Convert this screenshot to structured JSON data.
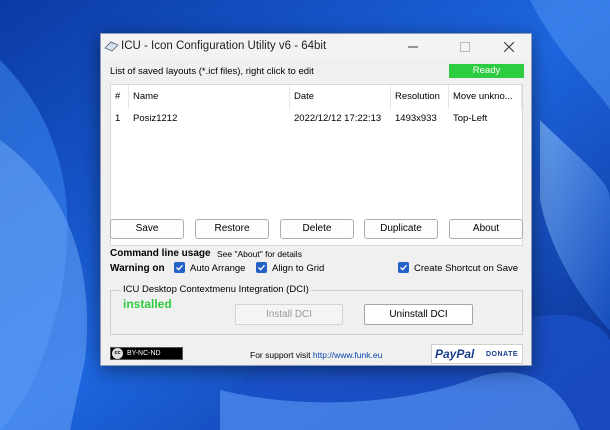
{
  "window": {
    "title": "ICU - Icon Configuration Utility v6 - 64bit"
  },
  "header": {
    "info_text": "List of saved layouts (*.icf files), right click to edit",
    "status": "Ready"
  },
  "colors": {
    "status_green": "#2ecc40",
    "checkbox_blue": "#2560c4",
    "link_blue": "#0645ad",
    "paypal_blue": "#1a3c8c"
  },
  "table": {
    "columns": [
      "#",
      "Name",
      "Date",
      "Resolution",
      "Move unkno..."
    ],
    "rows": [
      [
        "1",
        "Posiz1212",
        "2022/12/12 17:22:13",
        "1493x933",
        "Top-Left"
      ]
    ]
  },
  "buttons": {
    "save": "Save",
    "restore": "Restore",
    "delete": "Delete",
    "duplicate": "Duplicate",
    "about": "About"
  },
  "options": {
    "command_line_label": "Command line usage",
    "command_line_hint": "See \"About\" for details",
    "warning_label": "Warning on",
    "auto_arrange": "Auto Arrange",
    "align_to_grid": "Align to Grid",
    "create_shortcut": "Create Shortcut on Save"
  },
  "dci": {
    "group_title": "ICU Desktop Contextmenu Integration (DCI)",
    "status": "installed",
    "install_label": "Install DCI",
    "uninstall_label": "Uninstall DCI"
  },
  "footer": {
    "license_text": "BY-NC-ND",
    "license_badge": "cc",
    "support_text": "For support visit",
    "support_link": "http://www.funk.eu",
    "paypal_text": "PayPal",
    "donate_text": "DONATE"
  }
}
